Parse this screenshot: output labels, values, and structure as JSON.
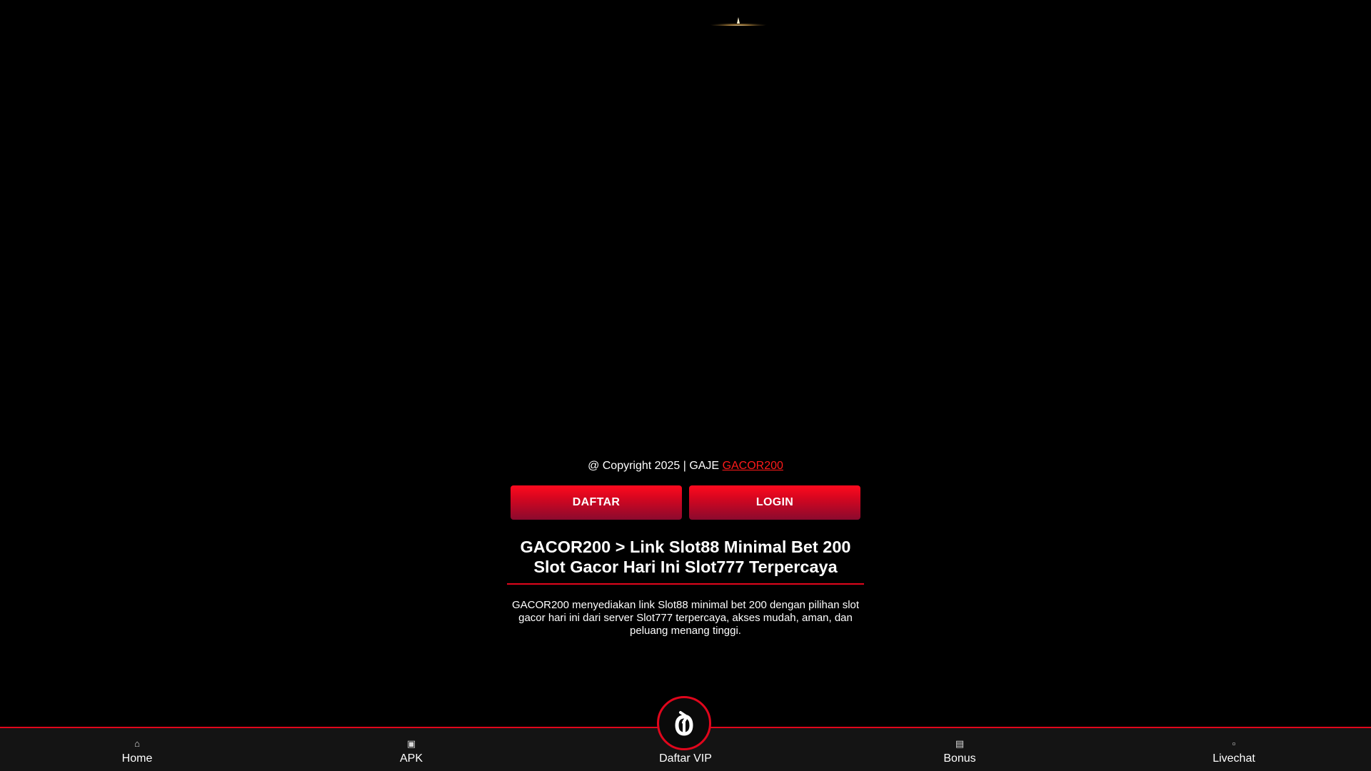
{
  "footer": {
    "copyright_prefix": "@ Copyright 2025 | GAJE",
    "copyright_link": "GACOR200"
  },
  "buttons": {
    "daftar": "DAFTAR",
    "login": "LOGIN"
  },
  "headline": {
    "line1": "GACOR200 > Link Slot88 Minimal Bet 200",
    "line2": "Slot Gacor Hari Ini Slot777 Terpercaya"
  },
  "description": "GACOR200 menyediakan link Slot88 minimal bet 200 dengan pilihan slot gacor hari ini dari server Slot777 terpercaya, akses mudah, aman, dan peluang menang tinggi.",
  "bottom_nav": {
    "items": [
      {
        "label": "Home",
        "icon": "home-icon"
      },
      {
        "label": "APK",
        "icon": "android-icon"
      },
      {
        "label": "Daftar VIP",
        "icon": "vip-logo-icon"
      },
      {
        "label": "Bonus",
        "icon": "gift-icon"
      },
      {
        "label": "Livechat",
        "icon": "chat-icon"
      }
    ]
  },
  "colors": {
    "background": "#000000",
    "accent_red": "#e0061c",
    "link_red": "#ff1a1a",
    "nav_background": "#141414"
  }
}
